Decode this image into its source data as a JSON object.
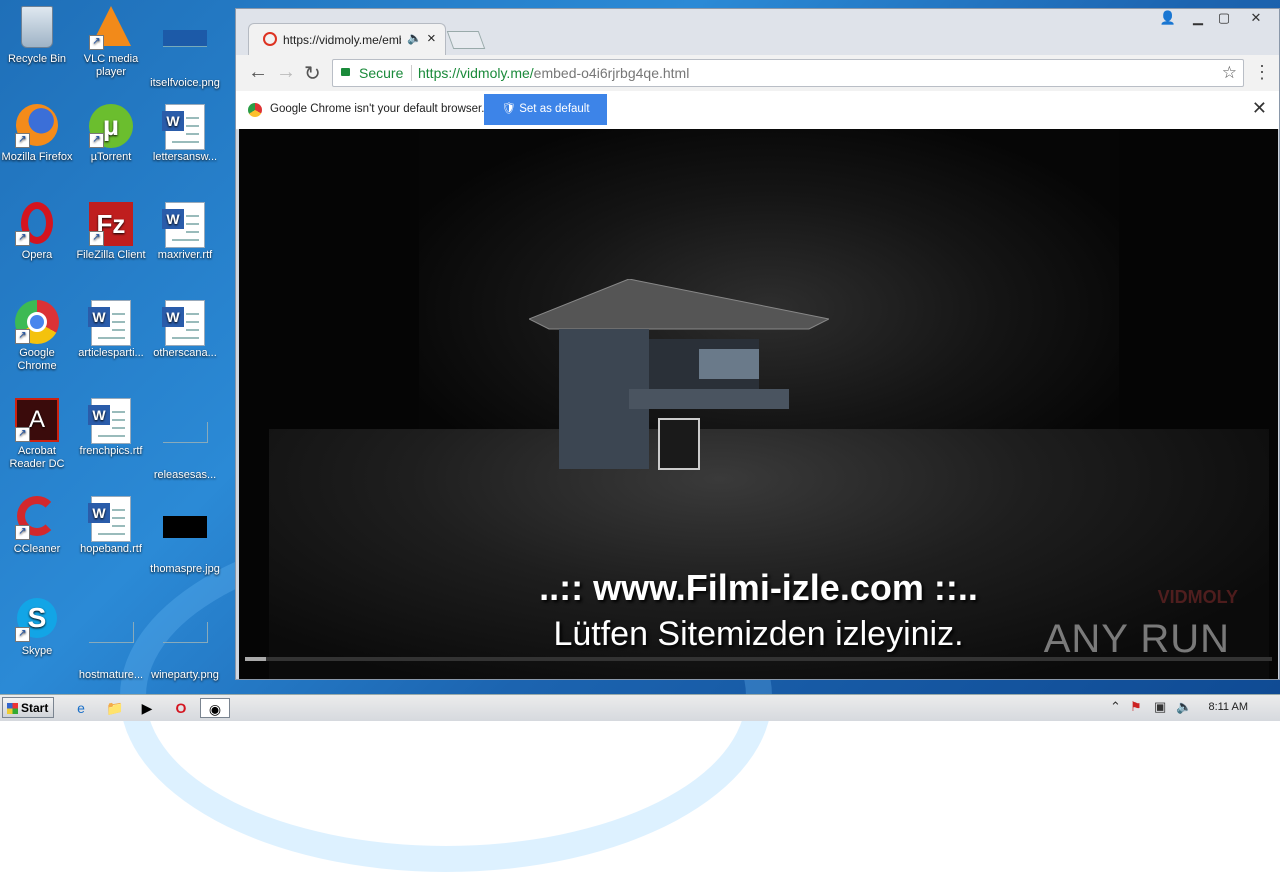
{
  "desktop": {
    "icons": [
      {
        "label": "Recycle Bin",
        "icon": "recycle-bin-icon"
      },
      {
        "label": "VLC media player",
        "icon": "vlc-icon"
      },
      {
        "label": "itselfvoice.png",
        "icon": "png-file-icon"
      },
      {
        "label": "Mozilla Firefox",
        "icon": "firefox-icon"
      },
      {
        "label": "µTorrent",
        "icon": "utorrent-icon"
      },
      {
        "label": "lettersansw...",
        "icon": "word-doc-icon"
      },
      {
        "label": "Opera",
        "icon": "opera-icon"
      },
      {
        "label": "FileZilla Client",
        "icon": "filezilla-icon"
      },
      {
        "label": "maxriver.rtf",
        "icon": "word-doc-icon"
      },
      {
        "label": "Google Chrome",
        "icon": "chrome-icon"
      },
      {
        "label": "articlesparti...",
        "icon": "word-doc-icon"
      },
      {
        "label": "otherscana...",
        "icon": "word-doc-icon"
      },
      {
        "label": "Acrobat Reader DC",
        "icon": "acrobat-icon"
      },
      {
        "label": "frenchpics.rtf",
        "icon": "word-doc-icon"
      },
      {
        "label": "releasesas...",
        "icon": "blank-file-icon"
      },
      {
        "label": "CCleaner",
        "icon": "ccleaner-icon"
      },
      {
        "label": "hopeband.rtf",
        "icon": "word-doc-icon"
      },
      {
        "label": "thomaspre.jpg",
        "icon": "jpg-file-icon"
      },
      {
        "label": "Skype",
        "icon": "skype-icon"
      },
      {
        "label": "hostmature...",
        "icon": "blank-file-icon"
      },
      {
        "label": "wineparty.png",
        "icon": "png-file-icon"
      }
    ]
  },
  "chrome": {
    "tab_title": "https://vidmoly.me/emb",
    "tab_audio_icon": "speaker-icon",
    "omnibox": {
      "secure_label": "Secure",
      "url_host": "https://vidmoly.me/",
      "url_path": "embed-o4i6rjrbg4qe.html"
    },
    "infobar": {
      "message": "Google Chrome isn't your default browser.",
      "button_label": "Set as default"
    }
  },
  "video": {
    "subtitle_line1": "..:: www.Filmi-izle.com ::..",
    "subtitle_line2": "Lütfen Sitemizden izleyiniz.",
    "watermark": "VIDMOLY",
    "overlay_brand": "ANY RUN",
    "progress": 0.02
  },
  "taskbar": {
    "start_label": "Start",
    "clock": "8:11 AM"
  }
}
